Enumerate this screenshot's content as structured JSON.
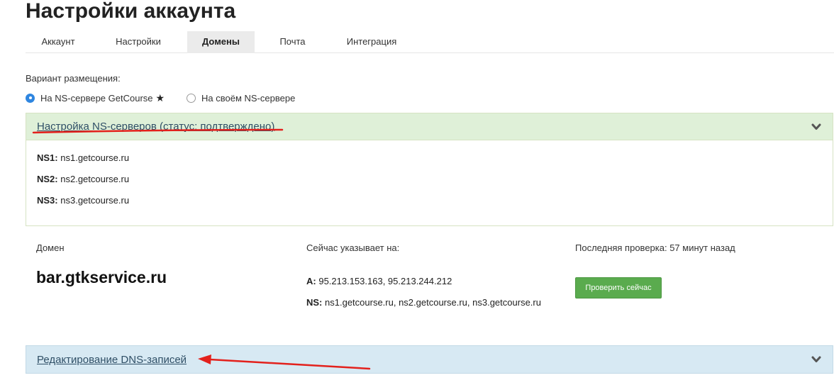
{
  "page": {
    "title": "Настройки аккаунта"
  },
  "tabs": [
    {
      "label": "Аккаунт",
      "active": false
    },
    {
      "label": "Настройки",
      "active": false
    },
    {
      "label": "Домены",
      "active": true
    },
    {
      "label": "Почта",
      "active": false
    },
    {
      "label": "Интеграция",
      "active": false
    }
  ],
  "placement": {
    "label": "Вариант размещения:",
    "options": [
      {
        "label": "На NS-сервере GetCourse",
        "checked": true,
        "star": "★"
      },
      {
        "label": "На своём NS-сервере",
        "checked": false
      }
    ]
  },
  "ns_panel": {
    "title": "Настройка NS-серверов (статус: подтверждено)",
    "rows": [
      {
        "key": "NS1:",
        "value": "ns1.getcourse.ru"
      },
      {
        "key": "NS2:",
        "value": "ns2.getcourse.ru"
      },
      {
        "key": "NS3:",
        "value": "ns3.getcourse.ru"
      }
    ]
  },
  "domain_info": {
    "domain_label": "Домен",
    "points_label": "Сейчас указывает на:",
    "last_check_label": "Последняя проверка: 57 минут назад",
    "domain": "bar.gtkservice.ru",
    "a_key": "A:",
    "a_value": "95.213.153.163, 95.213.244.212",
    "ns_key": "NS:",
    "ns_value": "ns1.getcourse.ru, ns2.getcourse.ru, ns3.getcourse.ru",
    "check_button": "Проверить сейчас"
  },
  "dns_panel": {
    "title": "Редактирование DNS-записей"
  },
  "colors": {
    "annotation": "#e3211c",
    "ns_header_bg": "#dff0d8",
    "dns_header_bg": "#d7e9f3",
    "check_button": "#5aab4e",
    "radio_accent": "#2f86e0"
  },
  "icons": {
    "panel_toggle": "chevron-down-icon",
    "favorite": "star-icon",
    "annotation_arrow": "red-arrow-annotation"
  }
}
